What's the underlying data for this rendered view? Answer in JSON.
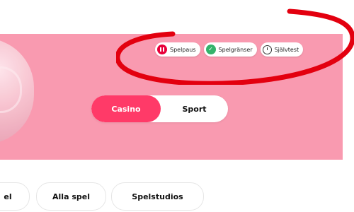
{
  "responsible_gaming": {
    "pause_label": "Spelpaus",
    "limits_label": "Spelgränser",
    "selftest_label": "Självtest",
    "icons": [
      "pause-icon",
      "limits-icon",
      "timer-icon"
    ]
  },
  "vertical_toggle": {
    "options": [
      "Casino",
      "Sport"
    ],
    "selected": "Casino"
  },
  "category_chips": [
    "el",
    "Alla spel",
    "Spelstudios"
  ],
  "colors": {
    "hero_bg": "#f99ab0",
    "accent": "#ff3a68",
    "pause_red": "#e8003a",
    "limits_green": "#34b36b",
    "annotation_red": "#e3000f"
  }
}
